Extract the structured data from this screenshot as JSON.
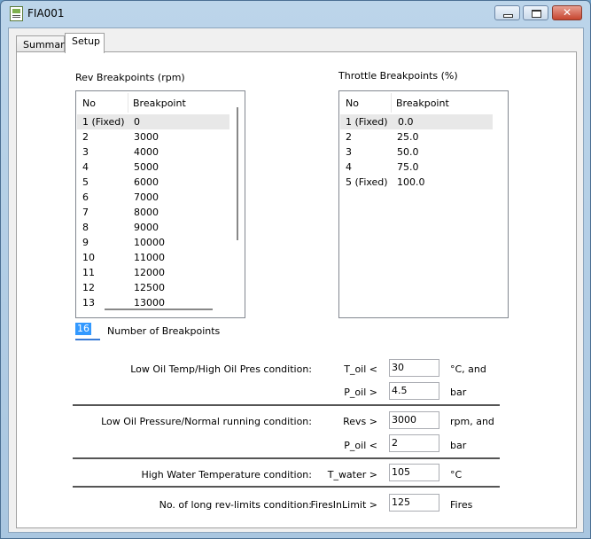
{
  "window": {
    "title": "FIA001",
    "icon": "app-document-icon",
    "controls": {
      "minimize": "minimize-icon",
      "maximize": "maximize-icon",
      "close": "✕"
    }
  },
  "tabs": [
    {
      "label": "Summary",
      "active": false
    },
    {
      "label": "Setup",
      "active": true
    }
  ],
  "rev": {
    "title": "Rev Breakpoints (rpm)",
    "col_no": "No",
    "col_bp": "Breakpoint",
    "rows": [
      {
        "no": "1 (Fixed)",
        "bp": "0"
      },
      {
        "no": "2",
        "bp": "3000"
      },
      {
        "no": "3",
        "bp": "4000"
      },
      {
        "no": "4",
        "bp": "5000"
      },
      {
        "no": "5",
        "bp": "6000"
      },
      {
        "no": "6",
        "bp": "7000"
      },
      {
        "no": "7",
        "bp": "8000"
      },
      {
        "no": "8",
        "bp": "9000"
      },
      {
        "no": "9",
        "bp": "10000"
      },
      {
        "no": "10",
        "bp": "11000"
      },
      {
        "no": "11",
        "bp": "12000"
      },
      {
        "no": "12",
        "bp": "12500"
      },
      {
        "no": "13",
        "bp": "13000"
      }
    ]
  },
  "throttle": {
    "title": "Throttle Breakpoints (%)",
    "col_no": "No",
    "col_bp": "Breakpoint",
    "rows": [
      {
        "no": "1 (Fixed)",
        "bp": "0.0"
      },
      {
        "no": "2",
        "bp": "25.0"
      },
      {
        "no": "3",
        "bp": "50.0"
      },
      {
        "no": "4",
        "bp": "75.0"
      },
      {
        "no": "5 (Fixed)",
        "bp": "100.0"
      }
    ]
  },
  "num_breakpoints": {
    "value": "16",
    "label": "Number of Breakpoints"
  },
  "conditions": {
    "low_oil_temp": {
      "label": "Low Oil Temp/High Oil Pres condition:",
      "t_oil": {
        "label": "T_oil <",
        "value": "30",
        "unit": "°C, and"
      },
      "p_oil": {
        "label": "P_oil >",
        "value": "4.5",
        "unit": "bar"
      }
    },
    "low_oil_pressure": {
      "label": "Low Oil Pressure/Normal running condition:",
      "revs": {
        "label": "Revs >",
        "value": "3000",
        "unit": "rpm, and"
      },
      "p_oil": {
        "label": "P_oil <",
        "value": "2",
        "unit": "bar"
      }
    },
    "high_water": {
      "label": "High Water Temperature condition:",
      "t_water": {
        "label": "T_water >",
        "value": "105",
        "unit": "°C"
      }
    },
    "long_rev": {
      "label": "No. of long rev-limits condition:",
      "fires": {
        "label": "FiresInLimit >",
        "value": "125",
        "unit": "Fires"
      }
    }
  }
}
